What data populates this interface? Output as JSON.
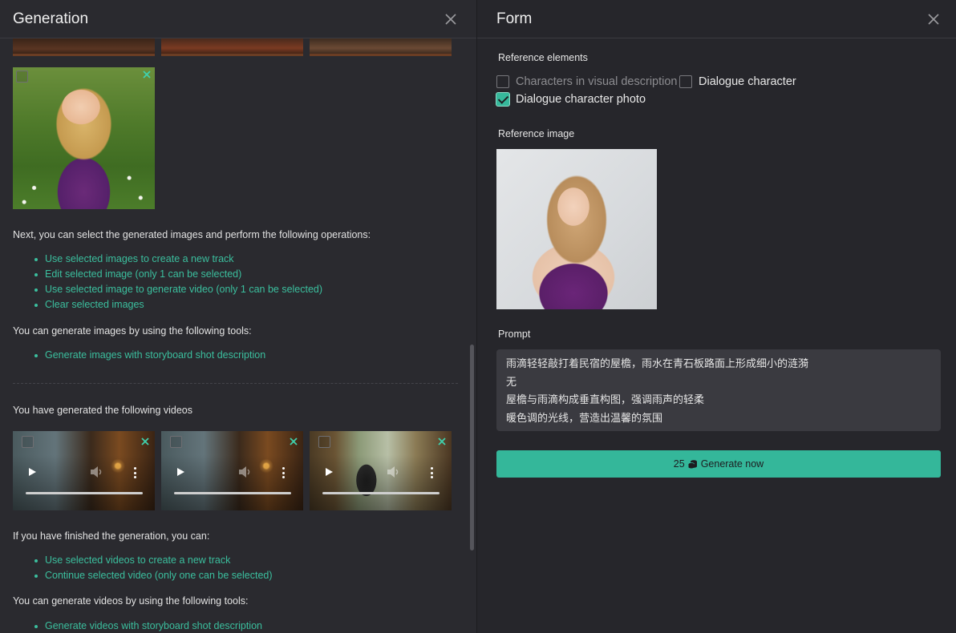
{
  "left_panel": {
    "title": "Generation",
    "close_icon": "close-icon",
    "ops_intro": "Next, you can select the generated images and perform the following operations:",
    "image_ops": [
      "Use selected images to create a new track",
      "Edit selected image (only 1 can be selected)",
      "Use selected image to generate video (only 1 can be selected)",
      "Clear selected images"
    ],
    "image_tools_intro": "You can generate images by using the following tools:",
    "image_tools": [
      "Generate images with storyboard shot description"
    ],
    "videos_intro": "You have generated the following videos",
    "finish_intro": "If you have finished the generation, you can:",
    "video_ops": [
      "Use selected videos to create a new track",
      "Continue selected video (only one can be selected)"
    ],
    "video_tools_intro": "You can generate videos by using the following tools:",
    "video_tools": [
      "Generate videos with storyboard shot description"
    ]
  },
  "right_panel": {
    "title": "Form",
    "close_icon": "close-icon",
    "reference_elements_label": "Reference elements",
    "options": [
      {
        "label": "Characters in visual description",
        "checked": false,
        "disabled": true
      },
      {
        "label": "Dialogue character",
        "checked": false,
        "disabled": false
      },
      {
        "label": "Dialogue character photo",
        "checked": true,
        "disabled": false
      }
    ],
    "reference_image_label": "Reference image",
    "prompt_label": "Prompt",
    "prompt_lines": [
      "雨滴轻轻敲打着民宿的屋檐，雨水在青石板路面上形成细小的涟漪",
      "无",
      "屋檐与雨滴构成垂直构图，强调雨声的轻柔",
      "暖色调的光线，营造出温馨的氛围"
    ],
    "generate_cost": "25",
    "generate_icon": "coins-icon",
    "generate_label": "Generate now"
  },
  "colors": {
    "accent": "#34b79a",
    "link": "#3bbf9e",
    "background": "#28282d"
  }
}
